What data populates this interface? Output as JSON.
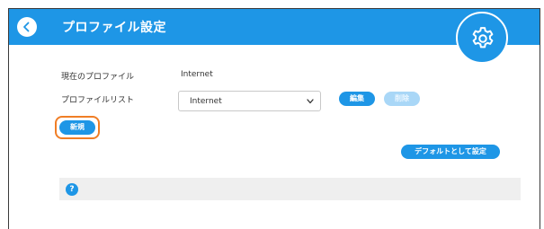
{
  "header": {
    "title": "プロファイル設定",
    "back_icon": "chevron-left-icon",
    "settings_icon": "gear-icon"
  },
  "profile": {
    "current_label": "現在のプロファイル",
    "current_value": "Internet",
    "list_label": "プロファイルリスト",
    "list_selected": "Internet"
  },
  "buttons": {
    "edit": "編集",
    "delete": "削除",
    "new": "新規",
    "set_default": "デフォルトとして設定"
  },
  "help": {
    "icon_text": "?"
  },
  "colors": {
    "accent": "#1e96e6",
    "disabled": "#a9d7f7",
    "highlight": "#f07e26"
  }
}
